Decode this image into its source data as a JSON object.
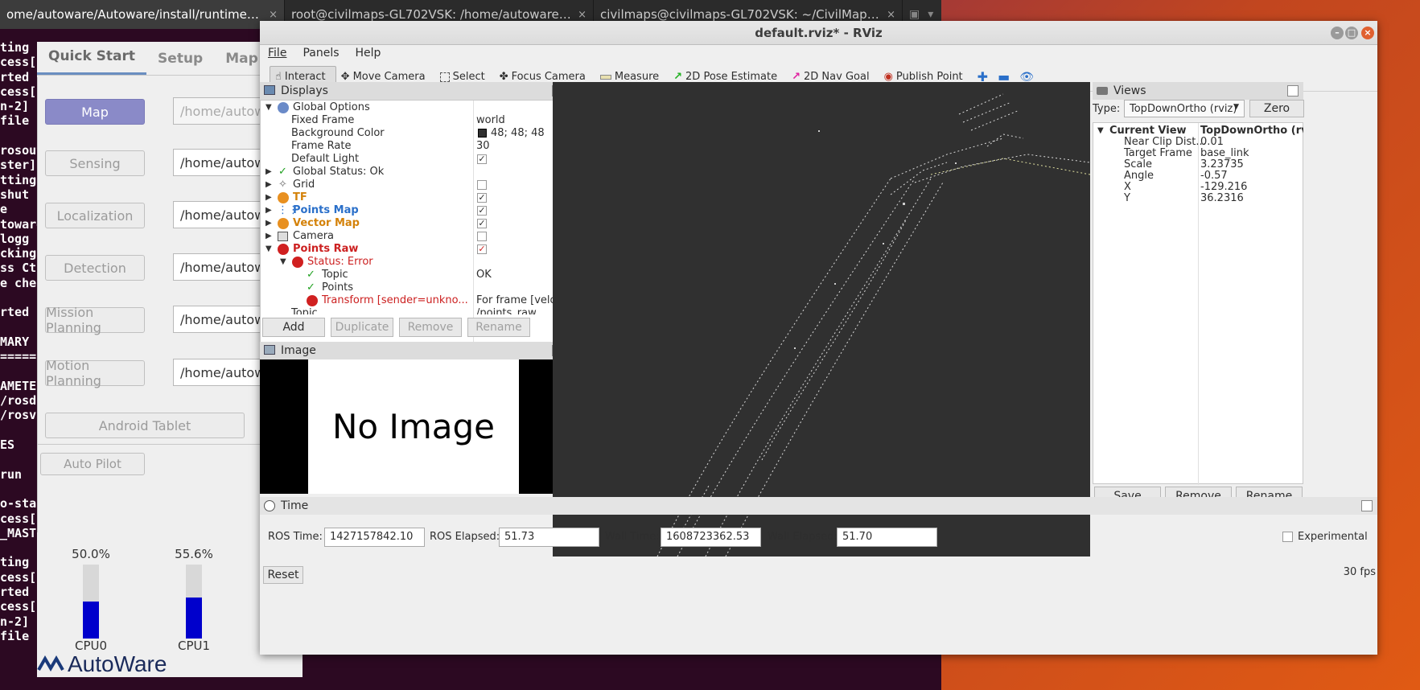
{
  "terminal": {
    "tabs": [
      {
        "title": "ome/autoware/Autoware/install/runtime_man...",
        "active": true
      },
      {
        "title": "root@civilmaps-GL702VSK: /home/autoware/Au...",
        "active": false
      },
      {
        "title": "civilmaps@civilmaps-GL702VSK: ~/CivilMapsCod...",
        "active": false
      }
    ],
    "close_glyph": "×",
    "lines": [
      "ting ,",
      "cess[",
      "rted",
      "cess[",
      "n-2]",
      "file",
      "",
      "rosout",
      "ster]",
      "tting",
      "shut",
      "e",
      "toware(",
      "logg",
      "cking",
      "ss Ct",
      "e chec",
      "",
      "rted",
      "",
      "MARY",
      "=====",
      "",
      "AMETER",
      "/rosd",
      "/rosv",
      "",
      "ES",
      "",
      "run",
      "",
      "o-sta",
      "cess[",
      "_MAST",
      "",
      "ting ,",
      "cess[",
      "rted",
      "cess[",
      "n-2]",
      "file"
    ]
  },
  "runtime_manager": {
    "tabs": [
      "Quick Start",
      "Setup",
      "Map"
    ],
    "rows": [
      {
        "label": "Map",
        "path": "/home/autoware/",
        "active": true
      },
      {
        "label": "Sensing",
        "path": "/home/autoware/"
      },
      {
        "label": "Localization",
        "path": "/home/autoware/"
      },
      {
        "label": "Detection",
        "path": "/home/autoware/"
      },
      {
        "label": "Mission Planning",
        "path": "/home/autoware/"
      },
      {
        "label": "Motion Planning",
        "path": "/home/autoware/"
      }
    ],
    "android_tablet": "Android Tablet",
    "auto_pilot": "Auto Pilot",
    "cpus": [
      {
        "label": "CPU0",
        "percent_text": "50.0%",
        "value": 0.5
      },
      {
        "label": "CPU1",
        "percent_text": "55.6%",
        "value": 0.556
      }
    ],
    "logo": "AutoWare"
  },
  "rviz": {
    "title": "default.rviz* - RViz",
    "menu": [
      "File",
      "Panels",
      "Help"
    ],
    "tools": [
      {
        "label": "Interact",
        "icon": "hand-icon",
        "active": true
      },
      {
        "label": "Move Camera",
        "icon": "move-icon"
      },
      {
        "label": "Select",
        "icon": "select-icon"
      },
      {
        "label": "Focus Camera",
        "icon": "focus-icon"
      },
      {
        "label": "Measure",
        "icon": "ruler-icon"
      },
      {
        "label": "2D Pose Estimate",
        "icon": "arrow-green-icon"
      },
      {
        "label": "2D Nav Goal",
        "icon": "arrow-pink-icon"
      },
      {
        "label": "Publish Point",
        "icon": "pin-icon"
      }
    ],
    "displays": {
      "title": "Displays",
      "global_options": "Global Options",
      "fixed_frame": {
        "label": "Fixed Frame",
        "value": "world"
      },
      "background_color": {
        "label": "Background Color",
        "value": "48; 48; 48",
        "swatch": "#303030"
      },
      "frame_rate": {
        "label": "Frame Rate",
        "value": "30"
      },
      "default_light": {
        "label": "Default Light",
        "checked": true
      },
      "global_status": "Global Status: Ok",
      "grid": {
        "label": "Grid",
        "checked": false
      },
      "tf": {
        "label": "TF",
        "checked": true,
        "color": "#d4820a"
      },
      "points_map": {
        "label": "Points Map",
        "checked": true,
        "color": "#2a6fc9"
      },
      "vector_map": {
        "label": "Vector Map",
        "checked": true,
        "color": "#d4820a"
      },
      "camera": {
        "label": "Camera",
        "checked": false
      },
      "points_raw": {
        "label": "Points Raw",
        "checked": true,
        "color": "#cc2020"
      },
      "status_error": "Status: Error",
      "topic": {
        "label": "Topic",
        "value": "OK"
      },
      "points": "Points",
      "transform": {
        "label": "Transform [sender=unkno...",
        "value": "For frame [velo..."
      },
      "topic2": {
        "label": "Topic",
        "value": "/points_raw"
      }
    },
    "display_buttons": [
      "Add",
      "Duplicate",
      "Remove",
      "Rename"
    ],
    "image": {
      "title": "Image",
      "text": "No Image"
    },
    "views": {
      "title": "Views",
      "type_label": "Type:",
      "type_value": "TopDownOrtho (rviz)",
      "zero": "Zero",
      "current_view": {
        "label": "Current View",
        "value": "TopDownOrtho (rvi..."
      },
      "props": [
        {
          "label": "Near Clip Dist...",
          "value": "0.01"
        },
        {
          "label": "Target Frame",
          "value": "base_link"
        },
        {
          "label": "Scale",
          "value": "3.23735"
        },
        {
          "label": "Angle",
          "value": "-0.57"
        },
        {
          "label": "X",
          "value": "-129.216"
        },
        {
          "label": "Y",
          "value": "36.2316"
        }
      ],
      "buttons": [
        "Save",
        "Remove",
        "Rename"
      ]
    },
    "time": {
      "title": "Time",
      "ros_time_label": "ROS Time:",
      "ros_time": "1427157842.10",
      "ros_elapsed_label": "ROS Elapsed:",
      "ros_elapsed": "51.73",
      "wall_time_label": "Wall Time:",
      "wall_time": "1608723362.53",
      "wall_elapsed_label": "Wall Elapsed:",
      "wall_elapsed": "51.70",
      "experimental": "Experimental",
      "reset": "Reset",
      "fps": "30 fps"
    }
  }
}
